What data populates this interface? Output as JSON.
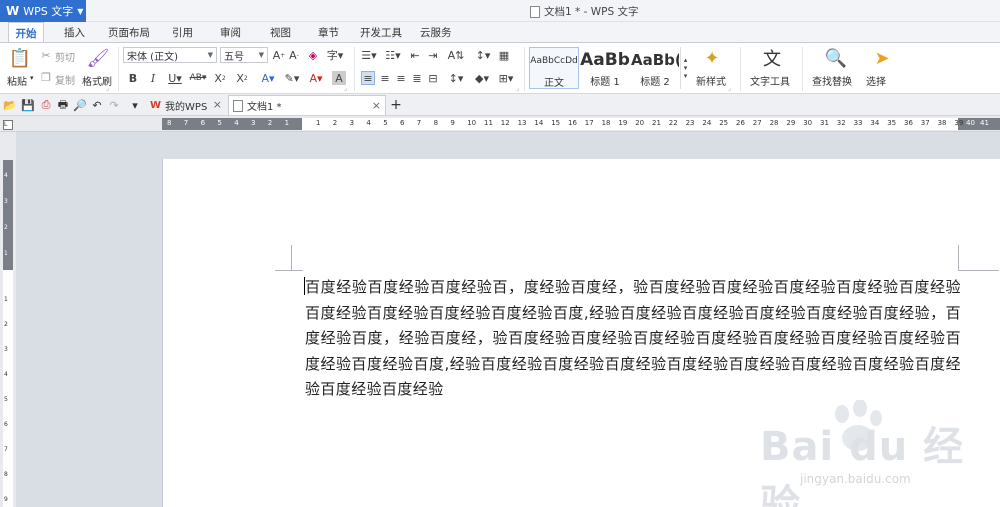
{
  "app": {
    "name": "WPS 文字",
    "window_title": "文档1 * - WPS 文字"
  },
  "menu_tabs": [
    "开始",
    "插入",
    "页面布局",
    "引用",
    "审阅",
    "视图",
    "章节",
    "开发工具",
    "云服务"
  ],
  "ribbon": {
    "clipboard": {
      "paste": "粘贴",
      "cut": "剪切",
      "copy": "复制",
      "format_painter": "格式刷"
    },
    "font": {
      "family": "宋体 (正文)",
      "size": "五号"
    },
    "styles": [
      {
        "sample": "AaBbCcDd",
        "name": "正文"
      },
      {
        "sample": "AaBb",
        "name": "标题 1"
      },
      {
        "sample": "AaBb(",
        "name": "标题 2"
      }
    ],
    "new_style": "新样式",
    "text_tools": "文字工具",
    "find_replace": "查找替换",
    "select": "选择"
  },
  "doc_tabs": [
    {
      "label": "我的WPS"
    },
    {
      "label": "文档1 *"
    }
  ],
  "ruler": {
    "left_nums": [
      "8",
      "7",
      "6",
      "5",
      "4",
      "3",
      "2",
      "1"
    ],
    "nums": [
      "1",
      "2",
      "3",
      "4",
      "5",
      "6",
      "7",
      "8",
      "9",
      "10",
      "11",
      "12",
      "13",
      "14",
      "15",
      "16",
      "17",
      "18",
      "19",
      "20",
      "21",
      "22",
      "23",
      "24",
      "25",
      "26",
      "27",
      "28",
      "29",
      "30",
      "31",
      "32",
      "33",
      "34",
      "35",
      "36",
      "37",
      "38",
      "39"
    ],
    "right_nums": [
      "40",
      "41"
    ],
    "v_top": [
      "4",
      "3",
      "2",
      "1"
    ],
    "v_nums": [
      "1",
      "2",
      "3",
      "4",
      "5",
      "6",
      "7",
      "8",
      "9"
    ]
  },
  "document": {
    "text": "百度经验百度经验百度经验百，度经验百度经，验百度经验百度经验百度经验百度经验百度经验百度经验百度经验百度经验百度经验百度,经验百度经验百度经验百度经验百度经验百度经验，百度经验百度，经验百度经，验百度经验百度经验百度经验百度经验百度经验百度经验百度经验百度经验百度经验百度,经验百度经验百度经验百度经验百度经验百度经验百度经验百度经验百度经验百度经验百度经验"
  },
  "watermark": {
    "brand": "Bai du 经验",
    "url": "jingyan.baidu.com"
  }
}
